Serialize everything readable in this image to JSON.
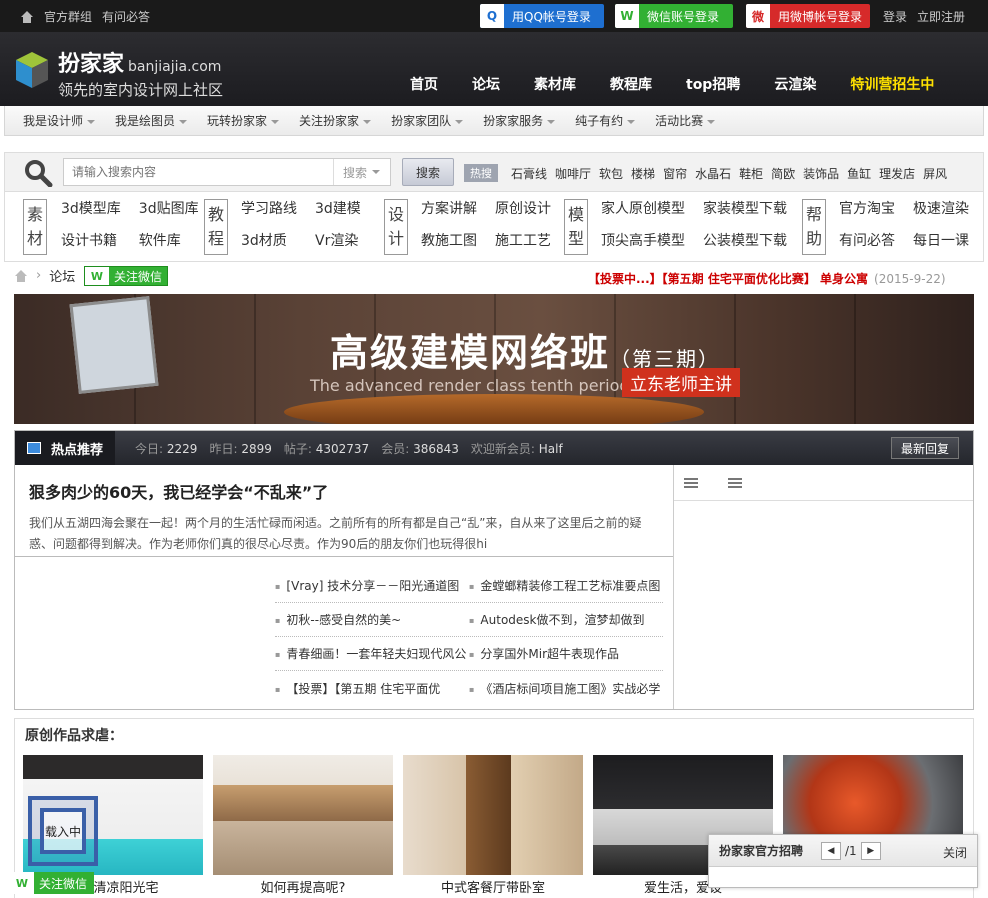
{
  "topbar": {
    "links": [
      "官方群组",
      "有问必答"
    ],
    "social": {
      "qq": "用QQ帐号登录",
      "wechat": "微信账号登录",
      "weibo": "用微博帐号登录"
    },
    "login": "登录",
    "register": "立即注册"
  },
  "brand": {
    "name": "扮家家",
    "domain": "banjiajia.com",
    "slogan": "领先的室内设计网上社区"
  },
  "main_nav": [
    "首页",
    "论坛",
    "素材库",
    "教程库",
    "top招聘",
    "云渲染",
    "特训营招生中"
  ],
  "sub_nav": [
    "我是设计师",
    "我是绘图员",
    "玩转扮家家",
    "关注扮家家",
    "扮家家团队",
    "扮家家服务",
    "纯子有约",
    "活动比赛"
  ],
  "search": {
    "placeholder": "请输入搜索内容",
    "select": "搜索",
    "button": "搜索",
    "hot_label": "热搜",
    "hot_words": [
      "石膏线",
      "咖啡厅",
      "软包",
      "楼梯",
      "窗帘",
      "水晶石",
      "鞋柜",
      "简欧",
      "装饰品",
      "鱼缸",
      "理发店",
      "屏风"
    ]
  },
  "categories": [
    {
      "tag": [
        "素",
        "材"
      ],
      "links": [
        "3d模型库",
        "3d贴图库",
        "设计书籍",
        "软件库"
      ]
    },
    {
      "tag": [
        "教",
        "程"
      ],
      "links": [
        "学习路线",
        "3d建模",
        "3d材质",
        "Vr渲染"
      ]
    },
    {
      "tag": [
        "设",
        "计"
      ],
      "links": [
        "方案讲解",
        "原创设计",
        "教施工图",
        "施工工艺"
      ]
    },
    {
      "tag": [
        "模",
        "型"
      ],
      "links": [
        "家人原创模型",
        "家装模型下载",
        "顶尖高手模型",
        "公装模型下载"
      ]
    },
    {
      "tag": [
        "帮",
        "助"
      ],
      "links": [
        "官方淘宝",
        "极速渲染",
        "有问必答",
        "每日一课"
      ]
    }
  ],
  "breadcrumb": {
    "current": "论坛",
    "follow_wechat": "关注微信"
  },
  "notice": {
    "text": "【投票中...】【第五期  住宅平面优化比赛】 单身公寓",
    "date": "(2015-9-22)"
  },
  "banner": {
    "title": "高级建模网络班",
    "sub": "（第三期）",
    "english": "The advanced render class tenth period",
    "tag": "立东老师主讲"
  },
  "hot": {
    "title": "热点推荐",
    "stats": [
      {
        "label": "今日:",
        "value": "2229"
      },
      {
        "label": "昨日:",
        "value": "2899"
      },
      {
        "label": "帖子:",
        "value": "4302737"
      },
      {
        "label": "会员:",
        "value": "386843"
      },
      {
        "label": "欢迎新会员:",
        "value": "Half"
      }
    ],
    "latest_button": "最新回复",
    "featured": {
      "title": "狠多肉少的60天，我已经学会“不乱来”了",
      "excerpt": "我们从五湖四海会聚在一起！两个月的生活忙碌而闲适。之前所有的所有都是自己“乱”来，自从来了这里后之前的疑惑、问题都得到解决。作为老师你们真的很尽心尽责。作为90后的朋友你们也玩得很hi"
    },
    "links": [
      [
        "[Vray] 技术分享－－阳光通道图",
        "金螳螂精装修工程工艺标准要点图"
      ],
      [
        "初秋--感受自然的美~",
        "Autodesk做不到，渲梦却做到"
      ],
      [
        "青春细画！一套年轻夫妇现代风公",
        "分享国外Mir超牛表现作品"
      ],
      [
        "【投票】【第五期  住宅平面优",
        "《酒店标间项目施工图》实战必学"
      ]
    ]
  },
  "works": {
    "title": "原创作品求虐：",
    "items": [
      "一改清凉阳光宅",
      "如何再提高呢?",
      "中式客餐厅带卧室",
      "爱生活，爱设",
      ""
    ]
  },
  "loading_text": "载入中",
  "footer_follow": "关注微信",
  "recruit": {
    "title": "扮家家官方招聘",
    "page": "/1",
    "close": "关闭"
  }
}
